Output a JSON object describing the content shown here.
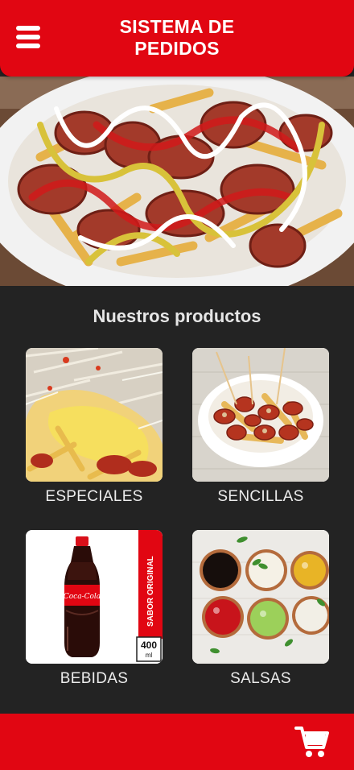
{
  "header": {
    "title_line1": "SISTEMA DE",
    "title_line2": "PEDIDOS",
    "menu_icon": "hamburger-menu-icon"
  },
  "hero": {
    "image": "salchipapa-hero-photo"
  },
  "products": {
    "heading": "Nuestros productos",
    "items": [
      {
        "label": "ESPECIALES",
        "image": "especiales-photo"
      },
      {
        "label": "SENCILLAS",
        "image": "sencillas-photo"
      },
      {
        "label": "BEBIDAS",
        "image": "bebidas-photo",
        "bottle_brand": "Coca-Cola",
        "bottle_badge": "SABOR ORIGINAL",
        "bottle_size": "400",
        "bottle_unit": "ml"
      },
      {
        "label": "SALSAS",
        "image": "salsas-photo"
      }
    ]
  },
  "footer": {
    "cart_icon": "shopping-cart-icon"
  },
  "colors": {
    "brand_red": "#e10612",
    "background": "#232323",
    "text_light": "#ececec"
  }
}
